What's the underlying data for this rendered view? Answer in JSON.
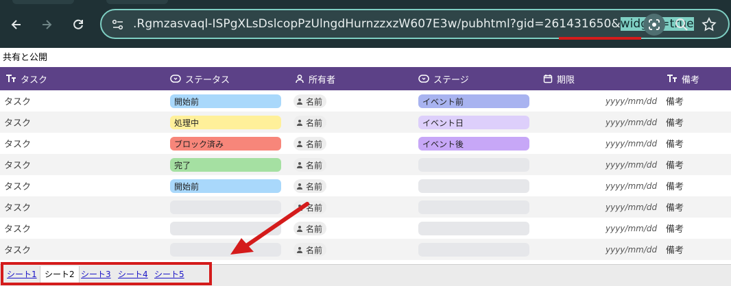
{
  "browser": {
    "url_main": ".Rgmzasvaql-ISPgXLsDslcopPzUlngdHurnzzxzW607E3w/pubhtml?gid=261431650&",
    "url_highlight": "widget=true"
  },
  "page": {
    "title": "共有と公開"
  },
  "headers": {
    "task": "タスク",
    "status": "ステータス",
    "owner": "所有者",
    "stage": "ステージ",
    "deadline": "期限",
    "notes": "備考"
  },
  "rows": [
    {
      "task": "タスク",
      "status": "開始前",
      "owner": "名前",
      "stage": "イベント前",
      "date": "yyyy/mm/dd",
      "notes": "備考"
    },
    {
      "task": "タスク",
      "status": "処理中",
      "owner": "名前",
      "stage": "イベント日",
      "date": "yyyy/mm/dd",
      "notes": "備考"
    },
    {
      "task": "タスク",
      "status": "ブロック済み",
      "owner": "名前",
      "stage": "イベント後",
      "date": "yyyy/mm/dd",
      "notes": "備考"
    },
    {
      "task": "タスク",
      "status": "完了",
      "owner": "名前",
      "stage": "",
      "date": "yyyy/mm/dd",
      "notes": "備考"
    },
    {
      "task": "タスク",
      "status": "開始前",
      "owner": "名前",
      "stage": "",
      "date": "yyyy/mm/dd",
      "notes": "備考"
    },
    {
      "task": "タスク",
      "status": "",
      "owner": "名前",
      "stage": "",
      "date": "yyyy/mm/dd",
      "notes": "備考"
    },
    {
      "task": "タスク",
      "status": "",
      "owner": "名前",
      "stage": "",
      "date": "yyyy/mm/dd",
      "notes": "備考"
    },
    {
      "task": "タスク",
      "status": "",
      "owner": "名前",
      "stage": "",
      "date": "yyyy/mm/dd",
      "notes": "備考"
    }
  ],
  "colors": {
    "header_bg": "#5c4187",
    "status": {
      "開始前": "#a9d8fb",
      "処理中": "#fff09a",
      "ブロック済み": "#f7867a",
      "完了": "#a5e0a2",
      "": "#e6e7ea"
    },
    "stage": {
      "イベント前": "#a8b3f0",
      "イベント日": "#ddcffb",
      "イベント後": "#c7a7f7",
      "": "#e6e7ea"
    },
    "annotation": "#d41b1b"
  },
  "sheet_tabs": [
    {
      "label": "シート1",
      "active": false
    },
    {
      "label": "シート2",
      "active": true
    },
    {
      "label": "シート3",
      "active": false
    },
    {
      "label": "シート4",
      "active": false
    },
    {
      "label": "シート5",
      "active": false
    }
  ]
}
